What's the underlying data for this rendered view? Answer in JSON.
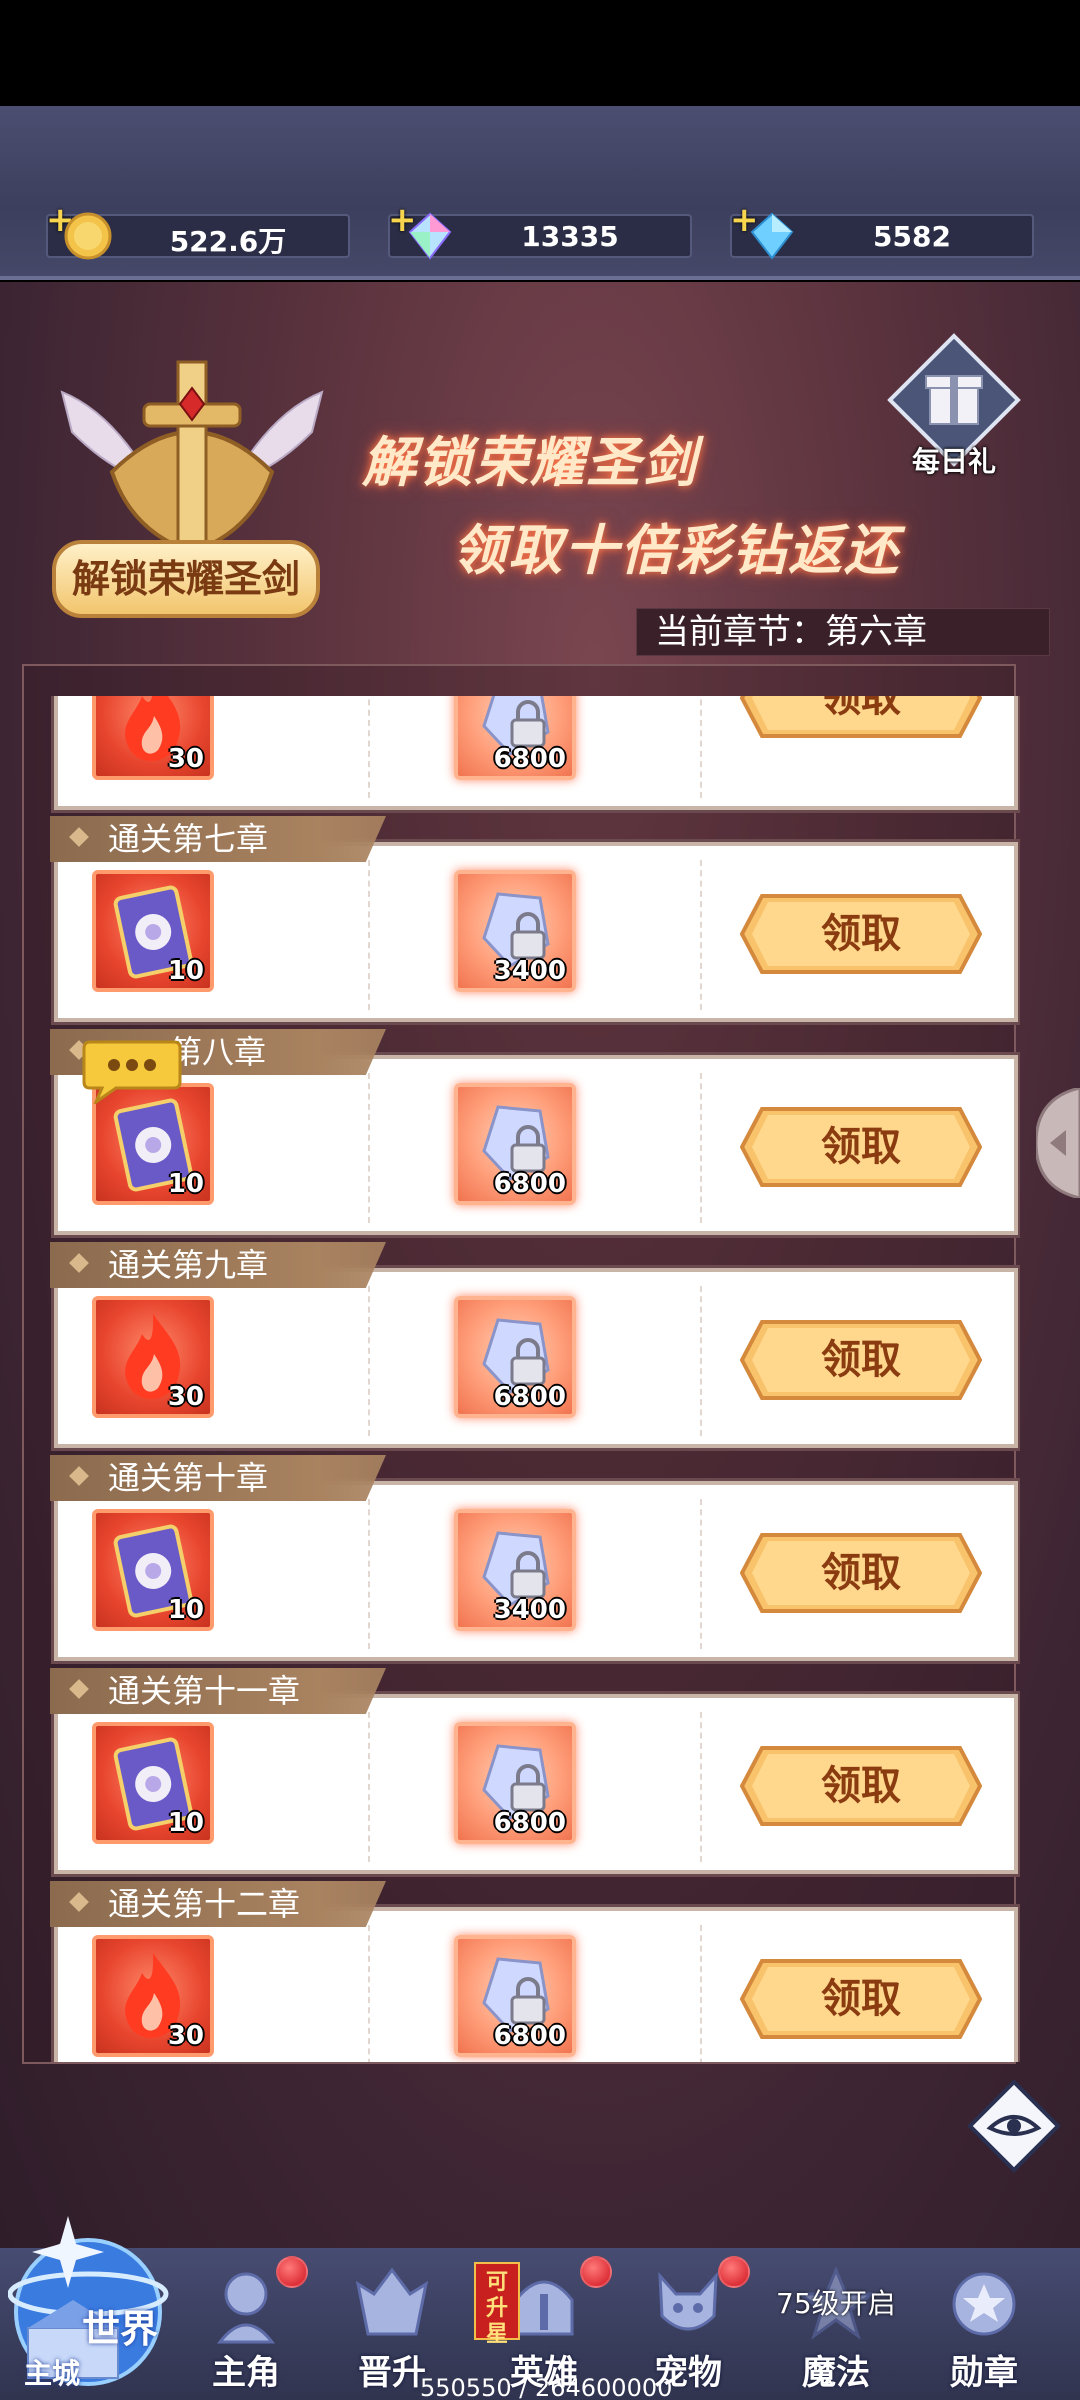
{
  "resources": {
    "gold": "522.6万",
    "rainbow_diamond": "13335",
    "diamond": "5582"
  },
  "banner": {
    "line1": "解锁荣耀圣剑",
    "line2": "领取十倍彩钻返还",
    "emblem_label": "解锁荣耀圣剑",
    "daily_gift_label": "每日礼"
  },
  "current_chapter": "当前章节：第六章",
  "rows": [
    {
      "title": "",
      "item1_type": "fire",
      "item1_count": "30",
      "item2_count": "6800",
      "claim_label": "领取"
    },
    {
      "title": "通关第七章",
      "item1_type": "card",
      "item1_count": "10",
      "item2_count": "3400",
      "claim_label": "领取"
    },
    {
      "title": "第八章",
      "item1_type": "card",
      "item1_count": "10",
      "item2_count": "6800",
      "claim_label": "领取"
    },
    {
      "title": "通关第九章",
      "item1_type": "fire",
      "item1_count": "30",
      "item2_count": "6800",
      "claim_label": "领取"
    },
    {
      "title": "通关第十章",
      "item1_type": "card",
      "item1_count": "10",
      "item2_count": "3400",
      "claim_label": "领取"
    },
    {
      "title": "通关第十一章",
      "item1_type": "card",
      "item1_count": "10",
      "item2_count": "6800",
      "claim_label": "领取"
    },
    {
      "title": "通关第十二章",
      "item1_type": "fire",
      "item1_count": "30",
      "item2_count": "6800",
      "claim_label": "领取"
    }
  ],
  "nav": {
    "world": "世界",
    "world_sub": "主城",
    "protagonist": "主角",
    "promote": "晋升",
    "hero": "英雄",
    "hero_tag": "可升星",
    "pet": "宠物",
    "magic": "魔法",
    "magic_lock": "75级开启",
    "medal": "勋章"
  },
  "progress_text": "550550 / 264600000"
}
